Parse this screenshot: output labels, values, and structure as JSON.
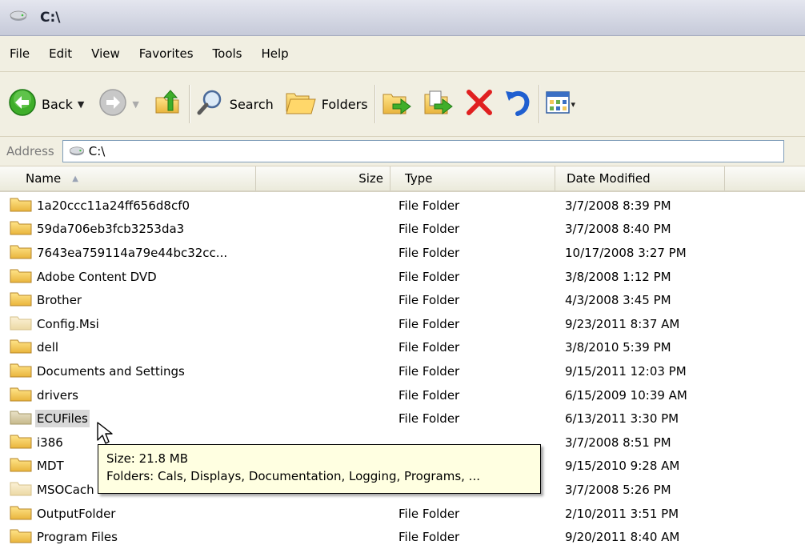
{
  "window": {
    "title": "C:\\"
  },
  "menu": {
    "items": [
      "File",
      "Edit",
      "View",
      "Favorites",
      "Tools",
      "Help"
    ]
  },
  "toolbar": {
    "back_label": "Back",
    "search_label": "Search",
    "folders_label": "Folders",
    "icons": [
      "back-icon",
      "forward-icon",
      "up-folder-icon",
      "search-icon",
      "folders-icon",
      "move-to-icon",
      "copy-to-icon",
      "delete-icon",
      "undo-icon",
      "views-icon"
    ]
  },
  "address": {
    "label": "Address",
    "value": "C:\\"
  },
  "columns": {
    "name": "Name",
    "size": "Size",
    "type": "Type",
    "date": "Date Modified"
  },
  "rows": [
    {
      "name": "1a20ccc11a24ff656d8cf0",
      "type": "File Folder",
      "date": "3/7/2008 8:39 PM"
    },
    {
      "name": "59da706eb3fcb3253da3",
      "type": "File Folder",
      "date": "3/7/2008 8:40 PM"
    },
    {
      "name": "7643ea759114a79e44bc32cc...",
      "type": "File Folder",
      "date": "10/17/2008 3:27 PM"
    },
    {
      "name": "Adobe Content DVD",
      "type": "File Folder",
      "date": "3/8/2008 1:12 PM"
    },
    {
      "name": "Brother",
      "type": "File Folder",
      "date": "4/3/2008 3:45 PM"
    },
    {
      "name": "Config.Msi",
      "type": "File Folder",
      "date": "9/23/2011 8:37 AM"
    },
    {
      "name": "dell",
      "type": "File Folder",
      "date": "3/8/2010 5:39 PM"
    },
    {
      "name": "Documents and Settings",
      "type": "File Folder",
      "date": "9/15/2011 12:03 PM"
    },
    {
      "name": "drivers",
      "type": "File Folder",
      "date": "6/15/2009 10:39 AM"
    },
    {
      "name": "ECUFiles",
      "type": "File Folder",
      "date": "6/13/2011 3:30 PM"
    },
    {
      "name": "i386",
      "type": "",
      "date": "3/7/2008 8:51 PM"
    },
    {
      "name": "MDT",
      "type": "",
      "date": "9/15/2010 9:28 AM"
    },
    {
      "name": "MSOCach",
      "type": "",
      "date": "3/7/2008 5:26 PM"
    },
    {
      "name": "OutputFolder",
      "type": "File Folder",
      "date": "2/10/2011 3:51 PM"
    },
    {
      "name": "Program Files",
      "type": "File Folder",
      "date": "9/20/2011 8:40 AM"
    }
  ],
  "tooltip": {
    "size_line": "Size: 21.8 MB",
    "folders_line": "Folders: Cals, Displays, Documentation, Logging, Programs, ..."
  },
  "colors": {
    "folder": "#f2c85b",
    "folder_hidden": "#f3e4bd",
    "folder_selected": "#d9cfae",
    "chrome": "#f1efe2",
    "tooltip_bg": "#ffffe1",
    "delete_red": "#e02020",
    "nav_green": "#3fae2a"
  }
}
